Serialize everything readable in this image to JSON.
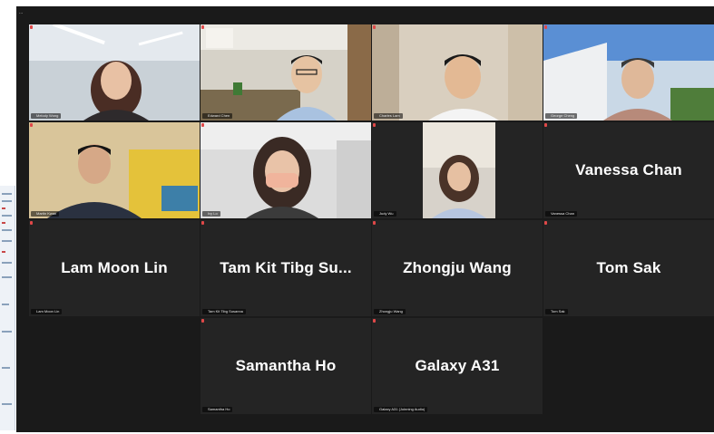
{
  "window": {
    "title_stub": "..."
  },
  "tiles": [
    {
      "id": "t1",
      "video": true,
      "name_label": "Melody Wong",
      "muted": true
    },
    {
      "id": "t2",
      "video": true,
      "name_label": "Edward Chen",
      "muted": true,
      "speaking": true
    },
    {
      "id": "t3",
      "video": true,
      "name_label": "Charles Lam",
      "muted": true
    },
    {
      "id": "t4",
      "video": true,
      "name_label": "George Cheng",
      "muted": true
    },
    {
      "id": "t5",
      "video": true,
      "name_label": "Martin Kwan",
      "muted": true
    },
    {
      "id": "t6",
      "video": true,
      "name_label": "Ivy Lo",
      "muted": true
    },
    {
      "id": "t7",
      "video": true,
      "name_label": "Judy Wu",
      "muted": true
    },
    {
      "id": "t8",
      "video": false,
      "display_name": "Vanessa Chan",
      "name_label": "Vanessa Chan",
      "muted": true
    },
    {
      "id": "t9",
      "video": false,
      "display_name": "Lam Moon Lin",
      "name_label": "Lam Moon Lin",
      "muted": true
    },
    {
      "id": "t10",
      "video": false,
      "display_name": "Tam Kit Tibg Su...",
      "name_label": "Tam Kit Tibg Susanna",
      "muted": true
    },
    {
      "id": "t11",
      "video": false,
      "display_name": "Zhongju Wang",
      "name_label": "Zhongju Wang",
      "muted": true
    },
    {
      "id": "t12",
      "video": false,
      "display_name": "Tom Sak",
      "name_label": "Tom Sak",
      "muted": true
    },
    {
      "id": "t13",
      "video": false,
      "display_name": "Samantha Ho",
      "name_label": "Samantha Ho",
      "muted": true
    },
    {
      "id": "t14",
      "video": false,
      "display_name": "Galaxy A31",
      "name_label": "Galaxy A31 (Joinning Audio)",
      "muted": true
    }
  ],
  "colors": {
    "background": "#1a1a1a",
    "tile": "#242424",
    "active_speaker": "#9ad33b",
    "mute": "#e04848"
  }
}
